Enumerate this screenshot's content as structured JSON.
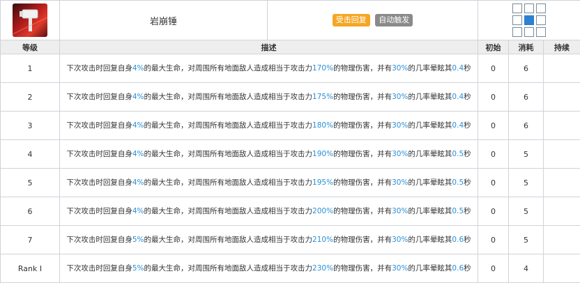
{
  "skill": {
    "name": "岩崩锤",
    "recovery_badge": "受击回复",
    "trigger_badge": "自动触发",
    "icon": "hammer-icon",
    "range_icon": "attack-range-grid",
    "colors": {
      "recovery_badge": "#f5a623",
      "trigger_badge": "#8a8a8a",
      "highlight": "#2a8fd6",
      "range_center": "#2f80d1"
    }
  },
  "headers": {
    "level": "等级",
    "description": "描述",
    "initial": "初始",
    "cost": "消耗",
    "duration": "持续"
  },
  "levels": [
    {
      "level": "1",
      "hp": "4%",
      "atk": "170%",
      "chance": "30%",
      "stun": "0.4",
      "initial": "0",
      "cost": "6",
      "duration": ""
    },
    {
      "level": "2",
      "hp": "4%",
      "atk": "175%",
      "chance": "30%",
      "stun": "0.4",
      "initial": "0",
      "cost": "6",
      "duration": ""
    },
    {
      "level": "3",
      "hp": "4%",
      "atk": "180%",
      "chance": "30%",
      "stun": "0.4",
      "initial": "0",
      "cost": "6",
      "duration": ""
    },
    {
      "level": "4",
      "hp": "4%",
      "atk": "190%",
      "chance": "30%",
      "stun": "0.5",
      "initial": "0",
      "cost": "5",
      "duration": ""
    },
    {
      "level": "5",
      "hp": "4%",
      "atk": "195%",
      "chance": "30%",
      "stun": "0.5",
      "initial": "0",
      "cost": "5",
      "duration": ""
    },
    {
      "level": "6",
      "hp": "4%",
      "atk": "200%",
      "chance": "30%",
      "stun": "0.5",
      "initial": "0",
      "cost": "5",
      "duration": ""
    },
    {
      "level": "7",
      "hp": "5%",
      "atk": "210%",
      "chance": "30%",
      "stun": "0.6",
      "initial": "0",
      "cost": "5",
      "duration": ""
    },
    {
      "level": "Rank I",
      "hp": "5%",
      "atk": "230%",
      "chance": "30%",
      "stun": "0.6",
      "initial": "0",
      "cost": "4",
      "duration": ""
    }
  ],
  "desc_text": {
    "p1": "下次攻击时回复自身",
    "p2": "的最大生命，对周围所有地面敌人造成相当于攻击力",
    "p3": "的物理伤害，并有",
    "p4": "的几率晕眩其",
    "p5": "秒"
  }
}
